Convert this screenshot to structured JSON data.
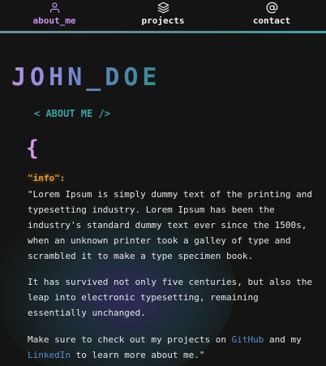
{
  "nav": {
    "items": [
      {
        "label": "about_me",
        "icon": "user-icon",
        "active": true
      },
      {
        "label": "projects",
        "icon": "layers-icon",
        "active": false
      },
      {
        "label": "contact",
        "icon": "at-sign-icon",
        "active": false
      }
    ]
  },
  "hero": {
    "title": "JOHN_DOE"
  },
  "section": {
    "tag": "< ABOUT ME />"
  },
  "code": {
    "open_brace": "{",
    "key": "\"info\":",
    "paragraph1": "\"Lorem Ipsum is simply dummy text of the printing and typesetting industry. Lorem Ipsum has been the industry's standard dummy text ever since the 1500s, when an unknown printer took a galley of type and scrambled it to make a type specimen book.",
    "paragraph2": "It has survived not only five centuries, but also the leap into electronic typesetting, remaining essentially unchanged.",
    "paragraph3_prefix": "Make sure to check out my projects on ",
    "github_link": "GitHub",
    "paragraph3_middle": " and my ",
    "linkedin_link": "LinkedIn",
    "paragraph3_suffix": " to learn more about me.\""
  },
  "colors": {
    "background": "#141414",
    "accent_purple": "#c892e8",
    "accent_teal": "#36a5a0",
    "key_orange": "#e39a3a",
    "link_blue": "#5590c8"
  }
}
